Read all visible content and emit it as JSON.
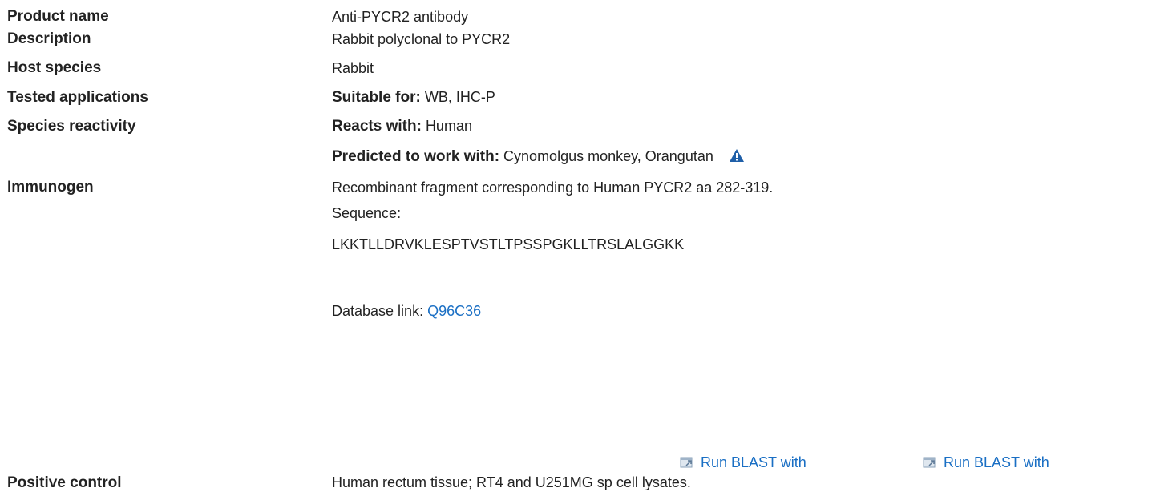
{
  "rows": {
    "product_name": {
      "label": "Product name",
      "value": "Anti-PYCR2 antibody"
    },
    "description": {
      "label": "Description",
      "value": "Rabbit polyclonal to PYCR2"
    },
    "host_species": {
      "label": "Host species",
      "value": "Rabbit"
    },
    "tested_applications": {
      "label": "Tested applications",
      "prefix": "Suitable for:",
      "value": "WB, IHC-P"
    },
    "species_reactivity": {
      "label": "Species reactivity",
      "reacts_prefix": "Reacts with:",
      "reacts_value": "Human",
      "predicted_prefix": "Predicted to work with:",
      "predicted_value": "Cynomolgus monkey, Orangutan",
      "warning_icon": "warning-triangle-icon"
    },
    "immunogen": {
      "label": "Immunogen",
      "description": "Recombinant fragment corresponding to Human PYCR2 aa 282-319.",
      "sequence_label": "Sequence:",
      "sequence": "LKKTLLDRVKLESPTVSTLTPSSPGKLLTRSLALGGKK",
      "database_prefix": "Database link:",
      "database_link": "Q96C36",
      "blast_label_1": "Run BLAST with",
      "blast_label_2": "Run BLAST with",
      "blast_icon": "external-link-icon"
    },
    "positive_control": {
      "label": "Positive control",
      "value": "Human rectum tissue; RT4 and U251MG sp cell lysates."
    }
  },
  "colors": {
    "link": "#1a6fc4",
    "warning": "#1f5fa8",
    "text": "#222222"
  }
}
